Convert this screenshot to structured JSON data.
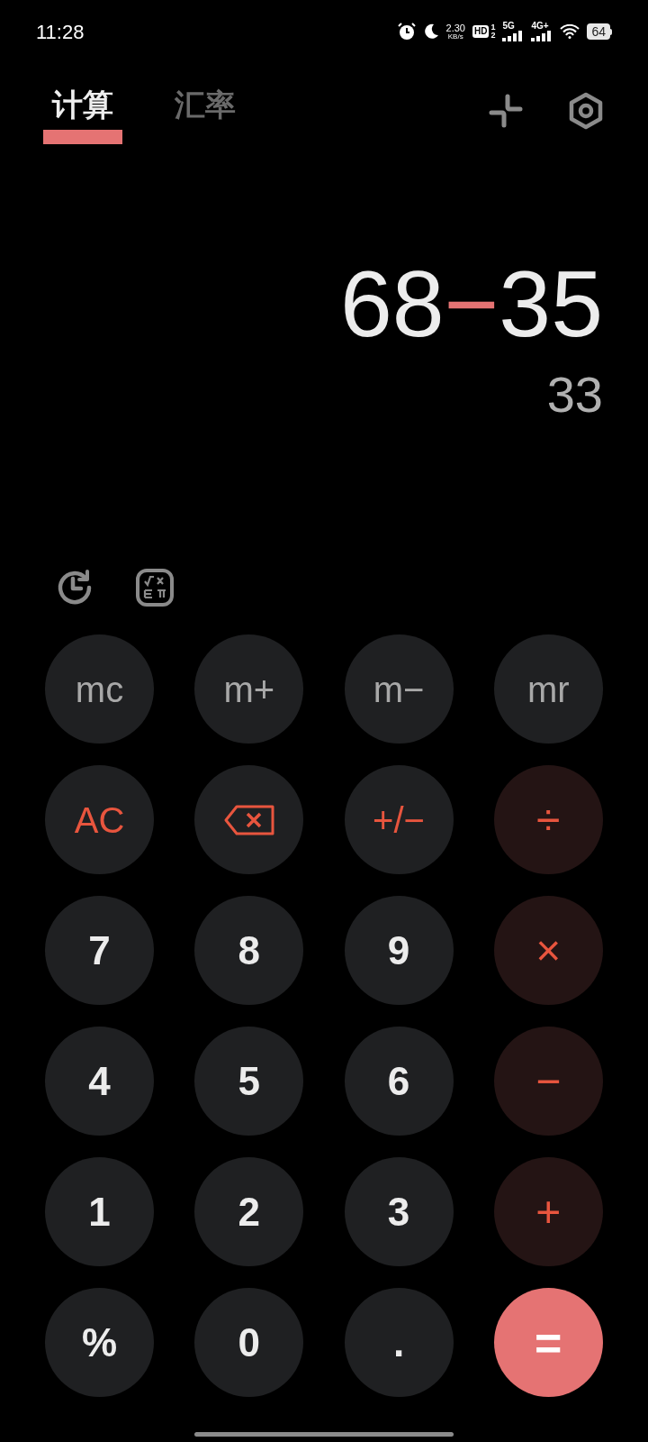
{
  "status_bar": {
    "time": "11:28",
    "net_speed": "2.30",
    "net_unit": "KB/s",
    "hd": "HD",
    "sim_slots": [
      "1",
      "2"
    ],
    "networks": [
      "5G",
      "4G+"
    ],
    "battery": "64"
  },
  "tabs": [
    {
      "label": "计算",
      "selected": true
    },
    {
      "label": "汇率",
      "selected": false
    }
  ],
  "display": {
    "expression": [
      {
        "kind": "number",
        "text": "68"
      },
      {
        "kind": "operator",
        "text": "−"
      },
      {
        "kind": "number",
        "text": "35"
      }
    ],
    "result": "33"
  },
  "keys": [
    {
      "kind": "memory",
      "label": "mc"
    },
    {
      "kind": "memory",
      "label": "m+"
    },
    {
      "kind": "memory",
      "label": "m−"
    },
    {
      "kind": "memory",
      "label": "mr"
    },
    {
      "kind": "function",
      "label": "AC"
    },
    {
      "kind": "backspace"
    },
    {
      "kind": "function",
      "label": "+/−"
    },
    {
      "kind": "operator",
      "label": "÷"
    },
    {
      "kind": "digit",
      "label": "7"
    },
    {
      "kind": "digit",
      "label": "8"
    },
    {
      "kind": "digit",
      "label": "9"
    },
    {
      "kind": "operator",
      "label": "×"
    },
    {
      "kind": "digit",
      "label": "4"
    },
    {
      "kind": "digit",
      "label": "5"
    },
    {
      "kind": "digit",
      "label": "6"
    },
    {
      "kind": "operator",
      "label": "−"
    },
    {
      "kind": "digit",
      "label": "1"
    },
    {
      "kind": "digit",
      "label": "2"
    },
    {
      "kind": "digit",
      "label": "3"
    },
    {
      "kind": "operator",
      "label": "+"
    },
    {
      "kind": "digit",
      "label": "%"
    },
    {
      "kind": "digit",
      "label": "0"
    },
    {
      "kind": "digit",
      "label": "."
    },
    {
      "kind": "equals",
      "label": "="
    }
  ]
}
